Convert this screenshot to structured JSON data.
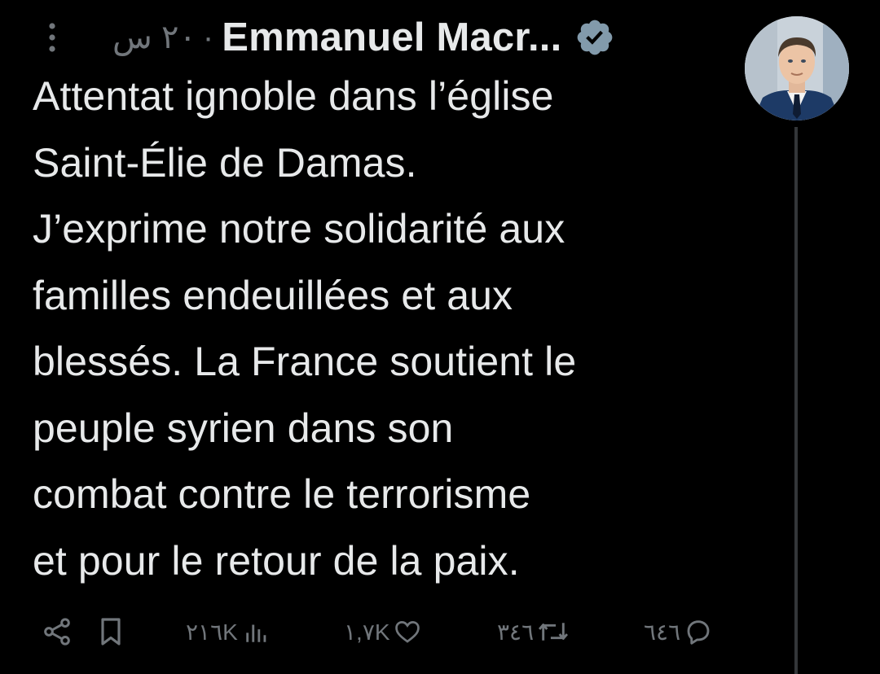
{
  "author": {
    "display_name": "Emmanuel Macr...",
    "verified": true,
    "avatar": "avatar-photo-man-in-suit"
  },
  "header": {
    "time": "٢٠ س",
    "separator": "·"
  },
  "tweet": {
    "lines": [
      "Attentat ignoble dans l’église",
      "Saint-Élie de Damas.",
      "J’exprime notre solidarité aux",
      "familles endeuillées et aux",
      "blessés. La France soutient le",
      "peuple syrien dans son",
      "combat contre le terrorisme",
      "et pour le retour de la paix."
    ]
  },
  "actions": {
    "share_icon": "share-icon",
    "bookmark_icon": "bookmark-icon",
    "views": "٢١٦K",
    "likes": "١,٧K",
    "reposts": "٣٤٦",
    "replies": "٦٤٦"
  },
  "colors": {
    "background": "#000000",
    "text": "#e7e9ea",
    "secondary": "#71767b",
    "verified_badge": "#829aab",
    "thread_line": "#333639"
  }
}
